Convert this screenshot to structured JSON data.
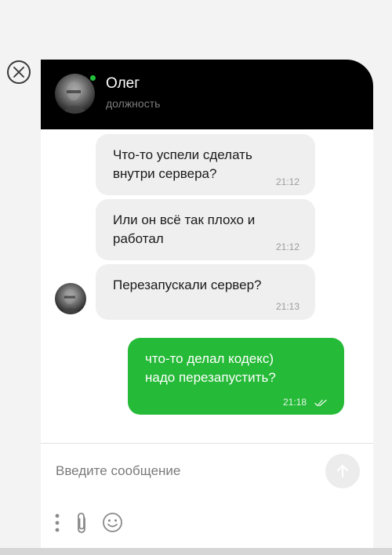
{
  "contact": {
    "name": "Олег",
    "role": "должность",
    "online_color": "#21c13a"
  },
  "messages": [
    {
      "direction": "incoming",
      "text": "Что-то успели сделать\nвнутри сервера?",
      "time": "21:12"
    },
    {
      "direction": "incoming",
      "text": "Или он всё так плохо и\nработал",
      "time": "21:12"
    },
    {
      "direction": "incoming",
      "text": "Перезапускали сервер?",
      "time": "21:13"
    },
    {
      "direction": "outgoing",
      "text": "что-то делал кодекс)\nнадо перезапустить?",
      "time": "21:18",
      "status": "read"
    }
  ],
  "composer": {
    "placeholder": "Введите сообщение"
  },
  "icons": {
    "close": "close-icon",
    "send": "arrow-up-icon",
    "more": "more-vertical-icon",
    "attach": "paperclip-icon",
    "emoji": "smiley-icon",
    "read": "double-check-icon"
  },
  "colors": {
    "header_bg": "#000000",
    "outgoing_bubble": "#25ba37",
    "incoming_bubble": "#efefef"
  }
}
